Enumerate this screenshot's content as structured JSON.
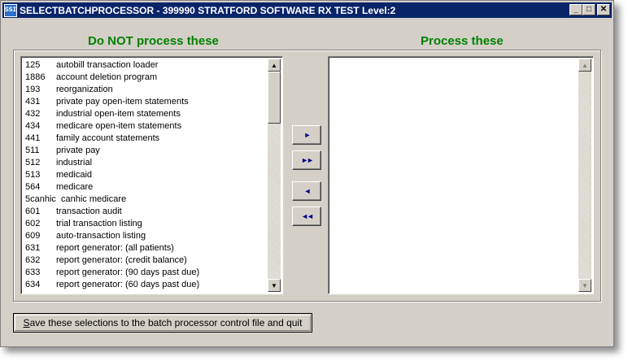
{
  "window": {
    "title": "SELECTBATCHPROCESSOR - 399990 STRATFORD SOFTWARE RX TEST Level:2",
    "icon_text": "SSI"
  },
  "left_panel": {
    "heading": "Do NOT process these",
    "items": [
      {
        "code": "125",
        "desc": "autobill transaction loader"
      },
      {
        "code": "1886",
        "desc": " account deletion program"
      },
      {
        "code": "193",
        "desc": "reorganization"
      },
      {
        "code": "431",
        "desc": "private pay open-item statements"
      },
      {
        "code": "432",
        "desc": "industrial open-item statements"
      },
      {
        "code": "434",
        "desc": "medicare open-item statements"
      },
      {
        "code": "441",
        "desc": "family account statements"
      },
      {
        "code": "511",
        "desc": "private pay"
      },
      {
        "code": "512",
        "desc": "industrial"
      },
      {
        "code": "513",
        "desc": "medicaid"
      },
      {
        "code": "564",
        "desc": "medicare"
      },
      {
        "code": "5canhic",
        "desc": "canhic medicare"
      },
      {
        "code": "601",
        "desc": "transaction audit"
      },
      {
        "code": "602",
        "desc": "trial transaction listing"
      },
      {
        "code": "609",
        "desc": "auto-transaction listing"
      },
      {
        "code": "631",
        "desc": "report generator: (all patients)"
      },
      {
        "code": "632",
        "desc": "report generator: (credit balance)"
      },
      {
        "code": "633",
        "desc": "report generator: (90 days past due)"
      },
      {
        "code": "634",
        "desc": "report generator: (60 days past due)"
      }
    ]
  },
  "right_panel": {
    "heading": "Process these",
    "items": []
  },
  "move_buttons": {
    "add_one": "►",
    "add_all": "►►",
    "remove_one": "◄",
    "remove_all": "◄◄"
  },
  "save_button": {
    "label": "Save these selections to the batch processor control file and quit"
  },
  "title_buttons": {
    "minimize": "_",
    "maximize": "□",
    "close": "✕"
  }
}
